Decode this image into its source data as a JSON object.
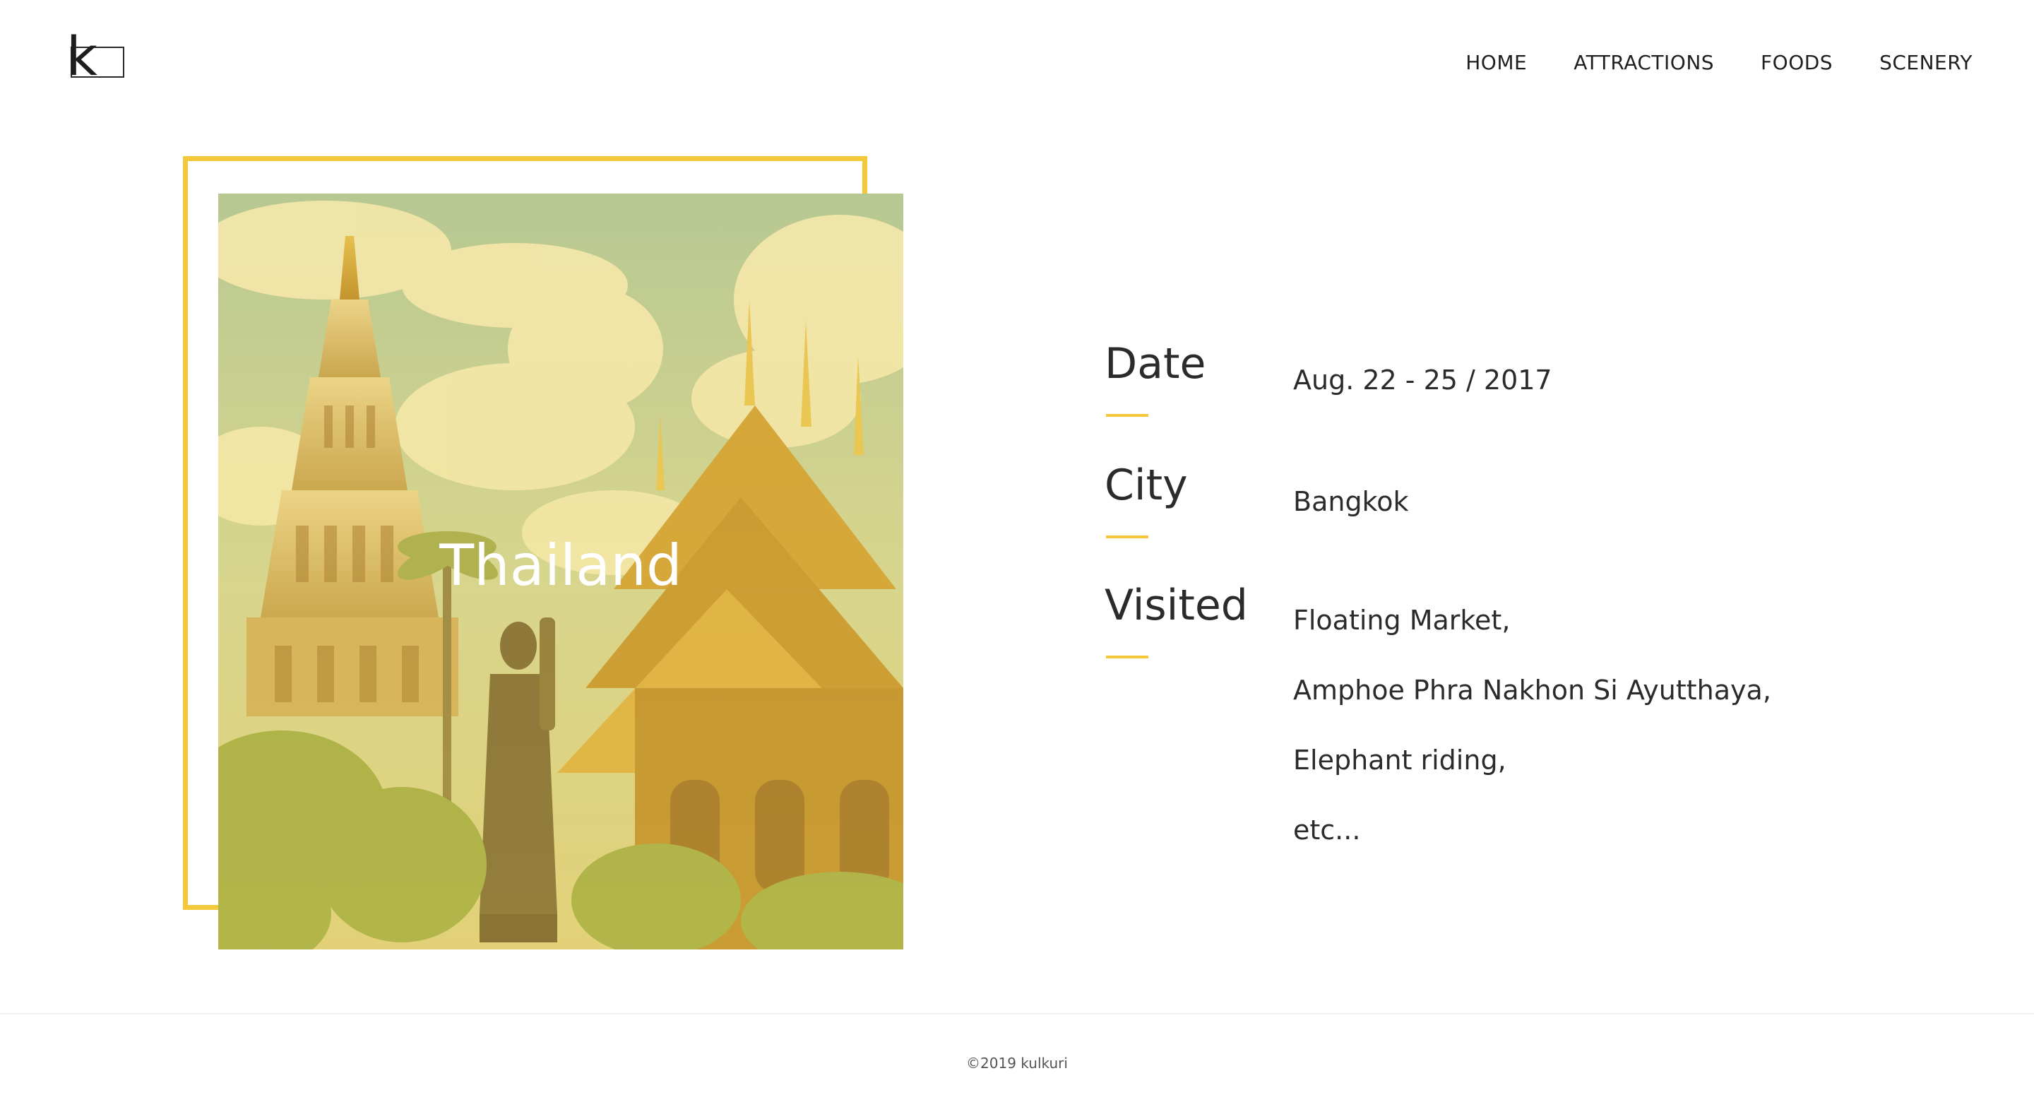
{
  "brand": {
    "logo_letter": "k"
  },
  "nav": {
    "items": [
      {
        "label": "HOME"
      },
      {
        "label": "ATTRACTIONS"
      },
      {
        "label": "FOODS"
      },
      {
        "label": "SCENERY"
      }
    ]
  },
  "hero": {
    "title": "Thailand",
    "image": "temple-photo"
  },
  "details": {
    "date": {
      "label": "Date",
      "value": "Aug. 22 - 25 / 2017"
    },
    "city": {
      "label": "City",
      "value": "Bangkok"
    },
    "visited": {
      "label": "Visited",
      "items": [
        "Floating Market,",
        "Amphoe Phra Nakhon Si Ayutthaya,",
        "Elephant riding,",
        "etc..."
      ]
    }
  },
  "footer": {
    "copyright": "©2019 kulkuri"
  },
  "colors": {
    "accent": "#f3c93b",
    "text": "#2b2b2b",
    "overlay": "#f0d060"
  }
}
